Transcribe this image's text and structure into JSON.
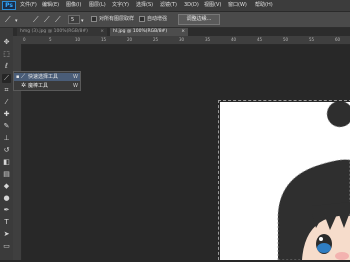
{
  "app": {
    "logo_text": "Ps"
  },
  "menubar": {
    "items": [
      {
        "label": "文件(F)"
      },
      {
        "label": "编辑(E)"
      },
      {
        "label": "图像(I)"
      },
      {
        "label": "图层(L)"
      },
      {
        "label": "文字(Y)"
      },
      {
        "label": "选择(S)"
      },
      {
        "label": "滤镜(T)"
      },
      {
        "label": "3D(D)"
      },
      {
        "label": "视图(V)"
      },
      {
        "label": "窗口(W)"
      },
      {
        "label": "帮助(H)"
      }
    ]
  },
  "options": {
    "brush_size": "5",
    "sample_all_layers_label": "对所有图层取样",
    "auto_enhance_label": "自动增强",
    "refine_edge_label": "调整边缘..."
  },
  "tabs": [
    {
      "label": "hmg (3).jpg @ 100%(RGB/8#)"
    },
    {
      "label": "hl.jpg @ 100%(RGB/8#)"
    }
  ],
  "ruler": {
    "ticks": [
      "0",
      "5",
      "10",
      "15",
      "20",
      "25",
      "30",
      "35",
      "40",
      "45",
      "50",
      "55",
      "60"
    ]
  },
  "flyout": {
    "items": [
      {
        "label": "快速选择工具",
        "shortcut": "W",
        "icon": "quick-selection-icon",
        "active": true
      },
      {
        "label": "魔棒工具",
        "shortcut": "W",
        "icon": "magic-wand-icon",
        "active": false
      }
    ]
  },
  "colors": {
    "accent": "#31a8ff",
    "menubar_bg": "#3c3c3c",
    "workspace_bg": "#282828"
  }
}
